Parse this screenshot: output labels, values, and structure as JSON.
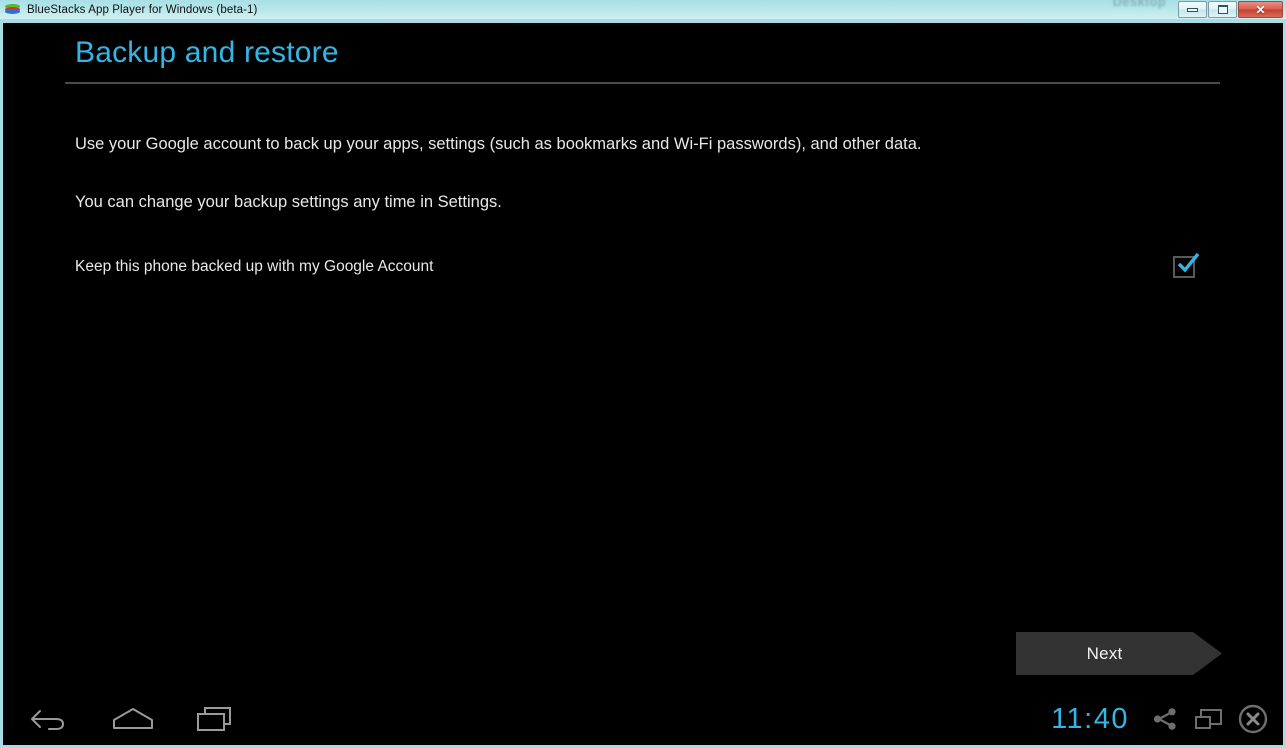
{
  "window": {
    "title": "BlueStacks App Player for Windows (beta-1)",
    "app_icon": "bluestacks-logo-icon",
    "desktop_bleed_text": "Desktop",
    "controls": {
      "minimize_label": "",
      "maximize_label": "",
      "close_label": "✕"
    }
  },
  "setup": {
    "title": "Backup and restore",
    "paragraphs": [
      "Use your Google account to back up your apps, settings (such as bookmarks and Wi-Fi passwords), and other data.",
      "You can change your backup settings any time in Settings."
    ],
    "toggle_label": "Keep this phone backed up with my Google Account",
    "toggle_checked": true,
    "next_label": "Next"
  },
  "system_bar": {
    "back_icon": "back-arrow-icon",
    "home_icon": "home-icon",
    "recents_icon": "recent-apps-icon",
    "clock": "11:40",
    "share_icon": "share-icon",
    "windowed_icon": "restore-window-icon",
    "close_icon": "close-circle-icon"
  },
  "colors": {
    "accent_blue": "#33b5e5",
    "frame_cyan": "#a7dde3",
    "screen_black": "#000000",
    "button_gray": "#333333",
    "text_light": "#e8e8e8",
    "divider_gray": "#4a4a4a",
    "icon_gray": "#8a8a8a"
  }
}
